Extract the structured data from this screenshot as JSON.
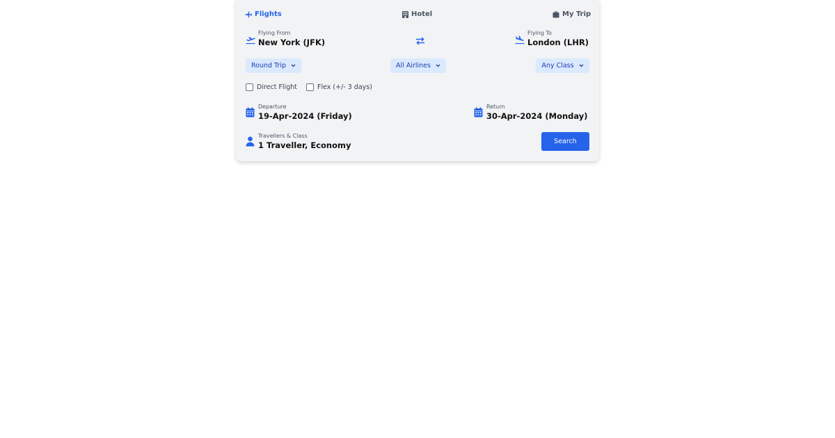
{
  "tabs": {
    "flights": "Flights",
    "hotel": "Hotel",
    "mytrip": "My Trip"
  },
  "from": {
    "label": "Flying From",
    "value": "New York (JFK)"
  },
  "to": {
    "label": "Flying To",
    "value": "London (LHR)"
  },
  "selects": {
    "trip_type": "Round Trip",
    "airlines": "All Airlines",
    "cabin_class": "Any Class"
  },
  "options": {
    "direct": "Direct Flight",
    "flex": "Flex (+/- 3 days)"
  },
  "departure": {
    "label": "Departure",
    "value": "19-Apr-2024 (Friday)"
  },
  "return": {
    "label": "Return",
    "value": "30-Apr-2024 (Monday)"
  },
  "travellers": {
    "label": "Travellers & Class",
    "value": "1 Traveller, Economy"
  },
  "search_button": "Search",
  "colors": {
    "accent": "#2563eb",
    "select_bg": "#dbe9fe",
    "card_bg": "#f2f3f5"
  },
  "icons": {
    "flights": "plane-icon",
    "hotel": "building-icon",
    "mytrip": "suitcase-icon",
    "from": "plane-departure-icon",
    "swap": "swap-arrows-icon",
    "to": "plane-arrival-icon",
    "calendar": "calendar-icon",
    "user": "user-icon",
    "chevron": "chevron-down-icon"
  }
}
